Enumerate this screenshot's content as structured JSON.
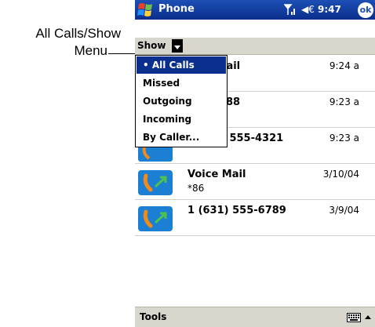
{
  "callout": {
    "line1": "All Calls/Show",
    "line2": "Menu"
  },
  "titlebar": {
    "title": "Phone",
    "time": "9:47",
    "volume_glyph": "◀€",
    "ok_label": "ok",
    "icons": [
      "windows-start-icon",
      "signal-icon",
      "volume-icon"
    ]
  },
  "showbar": {
    "label": "Show"
  },
  "menu": {
    "items": [
      {
        "label": "• All Calls",
        "selected": true
      },
      {
        "label": "Missed",
        "selected": false
      },
      {
        "label": "Outgoing",
        "selected": false
      },
      {
        "label": "Incoming",
        "selected": false
      },
      {
        "label": "By Caller...",
        "selected": false
      }
    ]
  },
  "calls": [
    {
      "name": "Voice Mail",
      "name_visible": "lail",
      "sub": "",
      "time": "9:24 a"
    },
    {
      "name": "",
      "name_visible": ")88",
      "sub": "",
      "time": "9:23 a"
    },
    {
      "name": "",
      "name_visible": ") 555-4321",
      "sub": "",
      "time": "9:23 a"
    },
    {
      "name": "Voice Mail",
      "name_visible": "Voice Mail",
      "sub": "*86",
      "time": "3/10/04"
    },
    {
      "name": "1 (631) 555-6789",
      "name_visible": "1 (631) 555-6789",
      "sub": "",
      "time": "3/9/04"
    }
  ],
  "toolbar": {
    "tools_label": "Tools"
  },
  "colors": {
    "titlebar": "#0a2f8c",
    "menu_selected": "#0a2f8c",
    "bars": "#d9d6cd"
  }
}
